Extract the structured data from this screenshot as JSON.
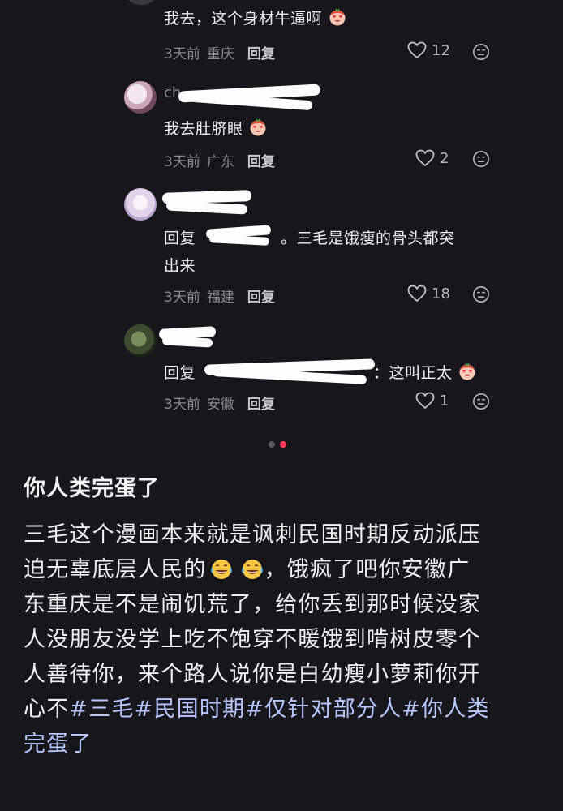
{
  "comments": [
    {
      "text": "我去，这个身材牛逼啊",
      "time": "3天前",
      "location": "重庆",
      "reply_label": "回复",
      "likes": "12"
    },
    {
      "username_visible": "ch",
      "text": "我去肚脐眼",
      "time": "3天前",
      "location": "广东",
      "reply_label": "回复",
      "likes": "2"
    },
    {
      "reply_prefix": "回复",
      "text_line1": "。三毛是饿瘦的骨头都突",
      "text_line2": "出来",
      "time": "3天前",
      "location": "福建",
      "reply_label": "回复",
      "likes": "18"
    },
    {
      "reply_prefix": "回复",
      "text": "：这叫正太",
      "time": "3天前",
      "location": "安徽",
      "reply_label": "回复",
      "likes": "1"
    }
  ],
  "pager": {
    "total": 2,
    "active": 2
  },
  "post": {
    "title": "你人类完蛋了",
    "body_lines": [
      "三毛这个漫画本来就是讽刺民国时期反动派压",
      "迫无辜底层人民的",
      "东重庆是不是闹饥荒了，给你丢到那时候没家",
      "人没朋友没学上吃不饱穿不暖饿到啃树皮零个",
      "人善待你，来个路人说你是白幼瘦小萝莉你开"
    ],
    "line2_tail": "，饿疯了吧你安徽广",
    "line6_plain": "心不",
    "tags": [
      "#三毛",
      "#民国时期",
      "#仅针对部分人",
      "#你人类"
    ],
    "line7": "完蛋了"
  },
  "icons": [
    "heart-icon",
    "smile-icon",
    "heart-eyes-emoji",
    "tears-of-joy-emoji"
  ],
  "colors": {
    "background": "#17161b",
    "tag": "#b6c8ff",
    "active_dot": "#ff3b5c"
  }
}
